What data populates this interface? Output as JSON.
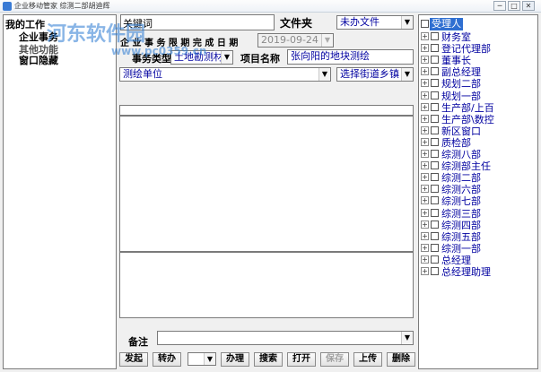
{
  "window": {
    "title": "企业移动管家 综测二部胡迪辉",
    "min": "─",
    "max": "□",
    "close": "✕"
  },
  "left": {
    "items": [
      "我的工作",
      "企业事务",
      "其他功能",
      "窗口隐藏"
    ]
  },
  "form": {
    "keyword_label": "关键词",
    "folder_label": "文件夹",
    "folder_value": "未办文件",
    "deadline_label": "企 业 事 务 限 期 完 成 日 期",
    "deadline_value": "2019-09-24",
    "type_label": "事务类型",
    "type_value": "土地勘测材",
    "project_label": "项目名称",
    "project_value": "张向阳的地块测绘",
    "unit_value": "测绘单位",
    "street_value": "选择街道乡镇",
    "note_label": "备注"
  },
  "toolbar": [
    "发起",
    "转办",
    "",
    "办理",
    "搜索",
    "打开",
    "保存",
    "上传",
    "删除"
  ],
  "tree": {
    "root": "受理人",
    "items": [
      "财务室",
      "登记代理部",
      "董事长",
      "副总经理",
      "规划二部",
      "规划一部",
      "生产部/上百",
      "生产部\\数控",
      "新区窗口",
      "质检部",
      "综测八部",
      "综测部主任",
      "综测二部",
      "综测六部",
      "综测七部",
      "综测三部",
      "综测四部",
      "综测五部",
      "综测一部",
      "总经理",
      "总经理助理"
    ]
  },
  "watermark": {
    "brand": "河东软件园",
    "url": "www.pc0359.cn"
  },
  "colors": {
    "accent": "#2f6fd1",
    "text_blue": "#0000a0"
  }
}
